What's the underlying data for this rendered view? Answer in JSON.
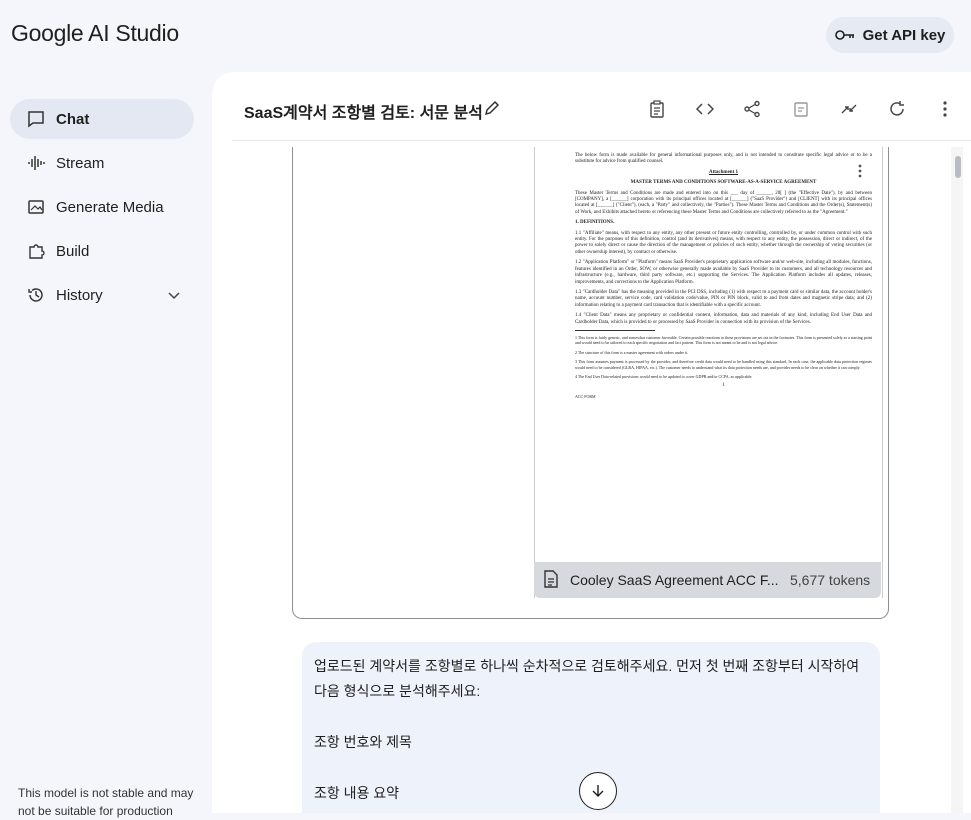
{
  "app": {
    "logo": "Google AI Studio",
    "api_button": "Get API key"
  },
  "sidebar": {
    "items": [
      {
        "label": "Chat",
        "icon": "chat-icon",
        "active": true
      },
      {
        "label": "Stream",
        "icon": "stream-icon"
      },
      {
        "label": "Generate Media",
        "icon": "media-icon"
      },
      {
        "label": "Build",
        "icon": "build-icon"
      },
      {
        "label": "History",
        "icon": "history-icon"
      }
    ],
    "note": "This model is not stable and may not be suitable for production"
  },
  "main": {
    "title": "SaaS계약서 조항별 검토: 서문 분석",
    "toolbar": [
      "clipboard-icon",
      "code-icon",
      "share-icon",
      "compare-icon",
      "compress-icon",
      "refresh-icon",
      "more-icon"
    ]
  },
  "attachment": {
    "filename": "Cooley SaaS Agreement ACC F...",
    "tokens": "5,677 tokens",
    "page": {
      "intro": "The below form is made available for general informational purposes only, and is not intended to constitute specific legal advice or to be a substitute for advice from qualified counsel.",
      "attachment_label": "Attachment 1",
      "heading": "MASTER TERMS AND CONDITIONS SOFTWARE-AS-A-SERVICE AGREEMENT",
      "para1": "These Master Terms and Conditions are made and entered into on this ___ day of ______, 20[ ] (the \"Effective Date\"), by and between [COMPANY], a [______] corporation with its principal offices located at [______] (\"SaaS Provider\") and [CLIENT] with its principal offices located at [______] (\"Client\"), (each, a \"Party\" and collectively, the \"Parties\"). These Master Terms and Conditions and the Order(s), Statement(s) of Work, and Exhibits attached hereto or referencing these Master Terms and Conditions are collectively referred to as the \"Agreement.\"",
      "section": "1.     DEFINITIONS.",
      "def1": "1.1     \"Affiliate\" means, with respect to any entity, any other present or future entity controlling, controlled by, or under common control with such entity. For the purposes of this definition, control (and its derivatives) means, with respect to any entity, the possession, direct or indirect, of the power to solely direct or cause the direction of the management or policies of such entity, whether through the ownership of voting securities (or other ownership interest), by contract or otherwise.",
      "def2": "1.2     \"Application Platform\" or \"Platform\" means SaaS Provider's proprietary application software and/or web-site, including all modules, functions, features identified in an Order, SOW, or otherwise generally made available by SaaS Provider to its customers, and all technology resources and infrastructure (e.g., hardware, third party software, etc.) supporting the Services. The Application Platform includes all updates, releases, improvements, and corrections to the Application Platform.",
      "def3": "1.3     \"Cardholder Data\" has the meaning provided in the PCI DSS, including (1) with respect to a payment card or similar data, the account holder's name, account number, service code, card validation code/value, PIN or PIN block, valid to and from dates and magnetic stripe data; and (2) information relating to a payment card transaction that is identifiable with a specific account.",
      "def4": "1.4     \"Client Data\" means any proprietary or confidential content, information, data and materials of any kind, including End User Data and Cardholder Data, which is provided to or processed by SaaS Provider in connection with its provision of the Services.",
      "fn1": "1 This form is fairly generic, and somewhat customer favorable. Certain possible reactions to these provisions are set out in the footnotes. This form is presented solely as a starting point and would need to be tailored to each specific negotiation and fact pattern. This form is not meant to be and is not legal advice.",
      "fn2": "2 The structure of this form is a master agreement with orders under it.",
      "fn3": "3 This form assumes payment is processed by the provider, and therefore credit data would need to be handled using this standard. In each case, the applicable data protection regimes would need to be considered (GLBA, HIPAA, etc.). The customer needs to understand what its data protection needs are, and provider needs to be clear on whether it can comply.",
      "fn4": "4 The End User Data-related provisions would need to be updated to cover GDPR and/or CCPA, as applicable.",
      "footer_left": "ACC FORM",
      "page_number": "1"
    }
  },
  "prompt": {
    "line1": "업로드된 계약서를 조항별로 하나씩 순차적으로 검토해주세요. 먼저 첫 번째 조항부터 시작하여 다음 형식으로 분석해주세요:",
    "line2": "조항 번호와 제목",
    "line3": "조항 내용 요약"
  }
}
